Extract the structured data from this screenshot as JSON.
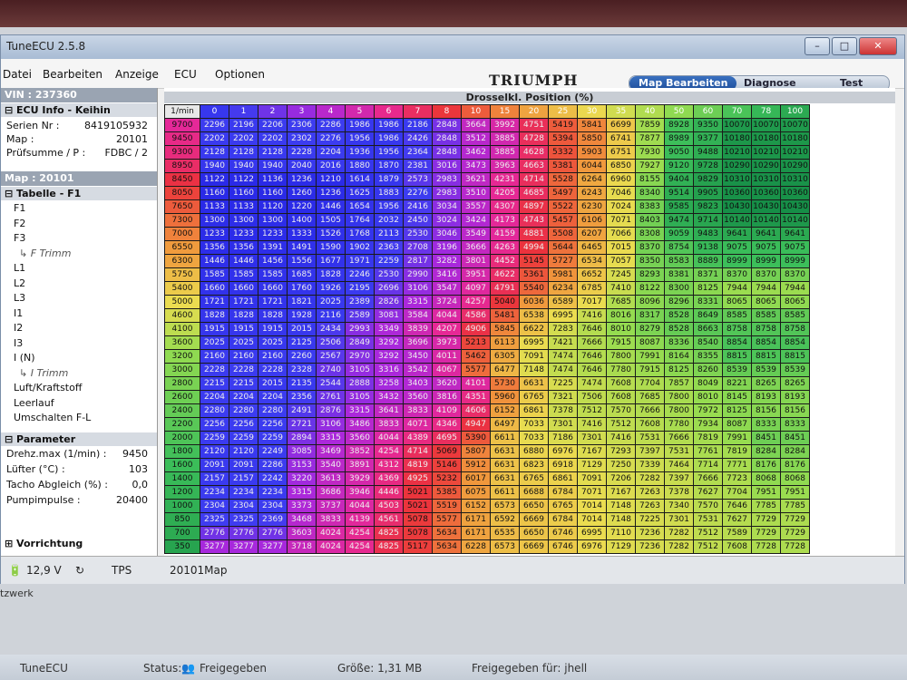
{
  "window": {
    "title": "TuneECU 2.5.8"
  },
  "menu": [
    "Datei",
    "Bearbeiten",
    "Anzeige",
    "ECU",
    "Optionen"
  ],
  "logo": "TRIUMPH",
  "tabs": {
    "map_edit": "Map Bearbeiten",
    "diagnose": "Diagnose",
    "test": "Test"
  },
  "left": {
    "vin": "VIN : 237360",
    "ecu_info": "ECU Info - Keihin",
    "ecu_rows": [
      {
        "k": "Serien Nr :",
        "v": "8419105932"
      },
      {
        "k": "Map :",
        "v": "20101"
      },
      {
        "k": "Prüfsumme / P :",
        "v": "FDBC / 2"
      }
    ],
    "map_header": "Map : 20101",
    "table_header": "Tabelle - F1",
    "tables": [
      "F1",
      "F2",
      "F3",
      "F Trimm",
      "L1",
      "L2",
      "L3",
      "I1",
      "I2",
      "I3",
      "I (N)",
      "I Trimm",
      "Luft/Kraftstoff",
      "Leerlauf",
      "Umschalten F-L"
    ],
    "param_header": "Parameter",
    "params": [
      {
        "k": "Drehz.max (1/min) :",
        "v": "9450"
      },
      {
        "k": "Lüfter (°C) :",
        "v": "103"
      },
      {
        "k": "Tacho Abgleich (%) :",
        "v": "0,0"
      },
      {
        "k": "Pumpimpulse :",
        "v": "20400"
      }
    ],
    "vorrichtung": "Vorrichtung"
  },
  "grid": {
    "title": "Drosselkl. Position (%)",
    "corner": "1/min",
    "cols": [
      "0",
      "1",
      "2",
      "3",
      "4",
      "5",
      "6",
      "7",
      "8",
      "10",
      "15",
      "20",
      "25",
      "30",
      "35",
      "40",
      "50",
      "60",
      "70",
      "78",
      "100"
    ],
    "rows": [
      {
        "rpm": "9700",
        "v": [
          "2296",
          "2196",
          "2206",
          "2306",
          "2286",
          "1986",
          "1986",
          "2186",
          "2848",
          "3664",
          "3992",
          "4751",
          "5419",
          "5841",
          "6699",
          "7859",
          "8928",
          "9350",
          "10070",
          "10070",
          "10070"
        ]
      },
      {
        "rpm": "9450",
        "v": [
          "2202",
          "2202",
          "2202",
          "2302",
          "2276",
          "1956",
          "1986",
          "2426",
          "2848",
          "3512",
          "3885",
          "4728",
          "5394",
          "5850",
          "6741",
          "7877",
          "8989",
          "9377",
          "10180",
          "10180",
          "10180"
        ]
      },
      {
        "rpm": "9300",
        "v": [
          "2128",
          "2128",
          "2128",
          "2228",
          "2204",
          "1936",
          "1956",
          "2364",
          "2848",
          "3462",
          "3885",
          "4628",
          "5332",
          "5903",
          "6751",
          "7930",
          "9050",
          "9488",
          "10210",
          "10210",
          "10210"
        ]
      },
      {
        "rpm": "8950",
        "v": [
          "1940",
          "1940",
          "1940",
          "2040",
          "2016",
          "1880",
          "1870",
          "2381",
          "3016",
          "3473",
          "3963",
          "4663",
          "5381",
          "6044",
          "6850",
          "7927",
          "9120",
          "9728",
          "10290",
          "10290",
          "10290"
        ]
      },
      {
        "rpm": "8450",
        "v": [
          "1122",
          "1122",
          "1136",
          "1236",
          "1210",
          "1614",
          "1879",
          "2573",
          "2983",
          "3621",
          "4231",
          "4714",
          "5528",
          "6264",
          "6960",
          "8155",
          "9404",
          "9829",
          "10310",
          "10310",
          "10310"
        ]
      },
      {
        "rpm": "8050",
        "v": [
          "1160",
          "1160",
          "1160",
          "1260",
          "1236",
          "1625",
          "1883",
          "2276",
          "2983",
          "3510",
          "4205",
          "4685",
          "5497",
          "6243",
          "7046",
          "8340",
          "9514",
          "9905",
          "10360",
          "10360",
          "10360"
        ]
      },
      {
        "rpm": "7650",
        "v": [
          "1133",
          "1133",
          "1120",
          "1220",
          "1446",
          "1654",
          "1956",
          "2416",
          "3034",
          "3557",
          "4307",
          "4897",
          "5522",
          "6230",
          "7024",
          "8383",
          "9585",
          "9823",
          "10430",
          "10430",
          "10430"
        ]
      },
      {
        "rpm": "7300",
        "v": [
          "1300",
          "1300",
          "1300",
          "1400",
          "1505",
          "1764",
          "2032",
          "2450",
          "3024",
          "3424",
          "4173",
          "4743",
          "5457",
          "6106",
          "7071",
          "8403",
          "9474",
          "9714",
          "10140",
          "10140",
          "10140"
        ]
      },
      {
        "rpm": "7000",
        "v": [
          "1233",
          "1233",
          "1233",
          "1333",
          "1526",
          "1768",
          "2113",
          "2530",
          "3046",
          "3549",
          "4159",
          "4881",
          "5508",
          "6207",
          "7066",
          "8308",
          "9059",
          "9483",
          "9641",
          "9641",
          "9641"
        ]
      },
      {
        "rpm": "6550",
        "v": [
          "1356",
          "1356",
          "1391",
          "1491",
          "1590",
          "1902",
          "2363",
          "2708",
          "3196",
          "3666",
          "4263",
          "4994",
          "5644",
          "6465",
          "7015",
          "8370",
          "8754",
          "9138",
          "9075",
          "9075",
          "9075"
        ]
      },
      {
        "rpm": "6300",
        "v": [
          "1446",
          "1446",
          "1456",
          "1556",
          "1677",
          "1971",
          "2259",
          "2817",
          "3282",
          "3801",
          "4452",
          "5145",
          "5727",
          "6534",
          "7057",
          "8350",
          "8583",
          "8889",
          "8999",
          "8999",
          "8999"
        ]
      },
      {
        "rpm": "5750",
        "v": [
          "1585",
          "1585",
          "1585",
          "1685",
          "1828",
          "2246",
          "2530",
          "2990",
          "3416",
          "3951",
          "4622",
          "5361",
          "5981",
          "6652",
          "7245",
          "8293",
          "8381",
          "8371",
          "8370",
          "8370",
          "8370"
        ]
      },
      {
        "rpm": "5400",
        "v": [
          "1660",
          "1660",
          "1660",
          "1760",
          "1926",
          "2195",
          "2696",
          "3106",
          "3547",
          "4097",
          "4791",
          "5540",
          "6234",
          "6785",
          "7410",
          "8122",
          "8300",
          "8125",
          "7944",
          "7944",
          "7944"
        ]
      },
      {
        "rpm": "5000",
        "v": [
          "1721",
          "1721",
          "1721",
          "1821",
          "2025",
          "2389",
          "2826",
          "3315",
          "3724",
          "4257",
          "5040",
          "6036",
          "6589",
          "7017",
          "7685",
          "8096",
          "8296",
          "8331",
          "8065",
          "8065",
          "8065"
        ]
      },
      {
        "rpm": "4600",
        "v": [
          "1828",
          "1828",
          "1828",
          "1928",
          "2116",
          "2589",
          "3081",
          "3584",
          "4044",
          "4586",
          "5481",
          "6538",
          "6995",
          "7416",
          "8016",
          "8317",
          "8528",
          "8649",
          "8585",
          "8585",
          "8585"
        ]
      },
      {
        "rpm": "4100",
        "v": [
          "1915",
          "1915",
          "1915",
          "2015",
          "2434",
          "2993",
          "3349",
          "3839",
          "4207",
          "4906",
          "5845",
          "6622",
          "7283",
          "7646",
          "8010",
          "8279",
          "8528",
          "8663",
          "8758",
          "8758",
          "8758"
        ]
      },
      {
        "rpm": "3600",
        "v": [
          "2025",
          "2025",
          "2025",
          "2125",
          "2506",
          "2849",
          "3292",
          "3696",
          "3973",
          "5213",
          "6113",
          "6995",
          "7421",
          "7666",
          "7915",
          "8087",
          "8336",
          "8540",
          "8854",
          "8854",
          "8854"
        ]
      },
      {
        "rpm": "3200",
        "v": [
          "2160",
          "2160",
          "2160",
          "2260",
          "2567",
          "2970",
          "3292",
          "3450",
          "4011",
          "5462",
          "6305",
          "7091",
          "7474",
          "7646",
          "7800",
          "7991",
          "8164",
          "8355",
          "8815",
          "8815",
          "8815"
        ]
      },
      {
        "rpm": "3000",
        "v": [
          "2228",
          "2228",
          "2228",
          "2328",
          "2740",
          "3105",
          "3316",
          "3542",
          "4067",
          "5577",
          "6477",
          "7148",
          "7474",
          "7646",
          "7780",
          "7915",
          "8125",
          "8260",
          "8539",
          "8539",
          "8539"
        ]
      },
      {
        "rpm": "2800",
        "v": [
          "2215",
          "2215",
          "2015",
          "2135",
          "2544",
          "2888",
          "3258",
          "3403",
          "3620",
          "4101",
          "5730",
          "6631",
          "7225",
          "7474",
          "7608",
          "7704",
          "7857",
          "8049",
          "8221",
          "8265",
          "8265"
        ]
      },
      {
        "rpm": "2600",
        "v": [
          "2204",
          "2204",
          "2204",
          "2356",
          "2761",
          "3105",
          "3432",
          "3560",
          "3816",
          "4351",
          "5960",
          "6765",
          "7321",
          "7506",
          "7608",
          "7685",
          "7800",
          "8010",
          "8145",
          "8193",
          "8193"
        ]
      },
      {
        "rpm": "2400",
        "v": [
          "2280",
          "2280",
          "2280",
          "2491",
          "2876",
          "3315",
          "3641",
          "3833",
          "4109",
          "4606",
          "6152",
          "6861",
          "7378",
          "7512",
          "7570",
          "7666",
          "7800",
          "7972",
          "8125",
          "8156",
          "8156"
        ]
      },
      {
        "rpm": "2200",
        "v": [
          "2256",
          "2256",
          "2256",
          "2721",
          "3106",
          "3486",
          "3833",
          "4071",
          "4346",
          "4947",
          "6497",
          "7033",
          "7301",
          "7416",
          "7512",
          "7608",
          "7780",
          "7934",
          "8087",
          "8333",
          "8333"
        ]
      },
      {
        "rpm": "2000",
        "v": [
          "2259",
          "2259",
          "2259",
          "2894",
          "3315",
          "3560",
          "4044",
          "4389",
          "4695",
          "5390",
          "6611",
          "7033",
          "7186",
          "7301",
          "7416",
          "7531",
          "7666",
          "7819",
          "7991",
          "8451",
          "8451"
        ]
      },
      {
        "rpm": "1800",
        "v": [
          "2120",
          "2120",
          "2249",
          "3085",
          "3469",
          "3852",
          "4254",
          "4714",
          "5069",
          "5807",
          "6631",
          "6880",
          "6976",
          "7167",
          "7293",
          "7397",
          "7531",
          "7761",
          "7819",
          "8284",
          "8284"
        ]
      },
      {
        "rpm": "1600",
        "v": [
          "2091",
          "2091",
          "2286",
          "3153",
          "3540",
          "3891",
          "4312",
          "4819",
          "5146",
          "5912",
          "6631",
          "6823",
          "6918",
          "7129",
          "7250",
          "7339",
          "7464",
          "7714",
          "7771",
          "8176",
          "8176"
        ]
      },
      {
        "rpm": "1400",
        "v": [
          "2157",
          "2157",
          "2242",
          "3220",
          "3613",
          "3929",
          "4369",
          "4925",
          "5232",
          "6017",
          "6631",
          "6765",
          "6861",
          "7091",
          "7206",
          "7282",
          "7397",
          "7666",
          "7723",
          "8068",
          "8068"
        ]
      },
      {
        "rpm": "1200",
        "v": [
          "2234",
          "2234",
          "2234",
          "3315",
          "3686",
          "3946",
          "4446",
          "5021",
          "5385",
          "6075",
          "6611",
          "6688",
          "6784",
          "7071",
          "7167",
          "7263",
          "7378",
          "7627",
          "7704",
          "7951",
          "7951"
        ]
      },
      {
        "rpm": "1000",
        "v": [
          "2304",
          "2304",
          "2304",
          "3373",
          "3737",
          "4044",
          "4503",
          "5021",
          "5519",
          "6152",
          "6573",
          "6650",
          "6765",
          "7014",
          "7148",
          "7263",
          "7340",
          "7570",
          "7646",
          "7785",
          "7785"
        ]
      },
      {
        "rpm": "850",
        "v": [
          "2325",
          "2325",
          "2369",
          "3468",
          "3833",
          "4139",
          "4561",
          "5078",
          "5577",
          "6171",
          "6592",
          "6669",
          "6784",
          "7014",
          "7148",
          "7225",
          "7301",
          "7531",
          "7627",
          "7729",
          "7729"
        ]
      },
      {
        "rpm": "700",
        "v": [
          "2776",
          "2776",
          "2776",
          "3603",
          "4024",
          "4254",
          "4825",
          "5078",
          "5634",
          "6171",
          "6535",
          "6650",
          "6746",
          "6995",
          "7110",
          "7236",
          "7282",
          "7512",
          "7589",
          "7729",
          "7729"
        ]
      },
      {
        "rpm": "350",
        "v": [
          "3277",
          "3277",
          "3277",
          "3718",
          "4024",
          "4254",
          "4825",
          "5117",
          "5634",
          "6228",
          "6573",
          "6669",
          "6746",
          "6976",
          "7129",
          "7236",
          "7282",
          "7512",
          "7608",
          "7728",
          "7728"
        ]
      }
    ]
  },
  "status": {
    "voltage": "12,9 V",
    "tps": "TPS",
    "map": "20101Map"
  },
  "taskbar": {
    "app": "TuneECU",
    "status_label": "Status:",
    "status_value": "Freigegeben",
    "size": "Größe: 1,31 MB",
    "shared": "Freigegeben für: jhell",
    "network": "tzwerk"
  }
}
